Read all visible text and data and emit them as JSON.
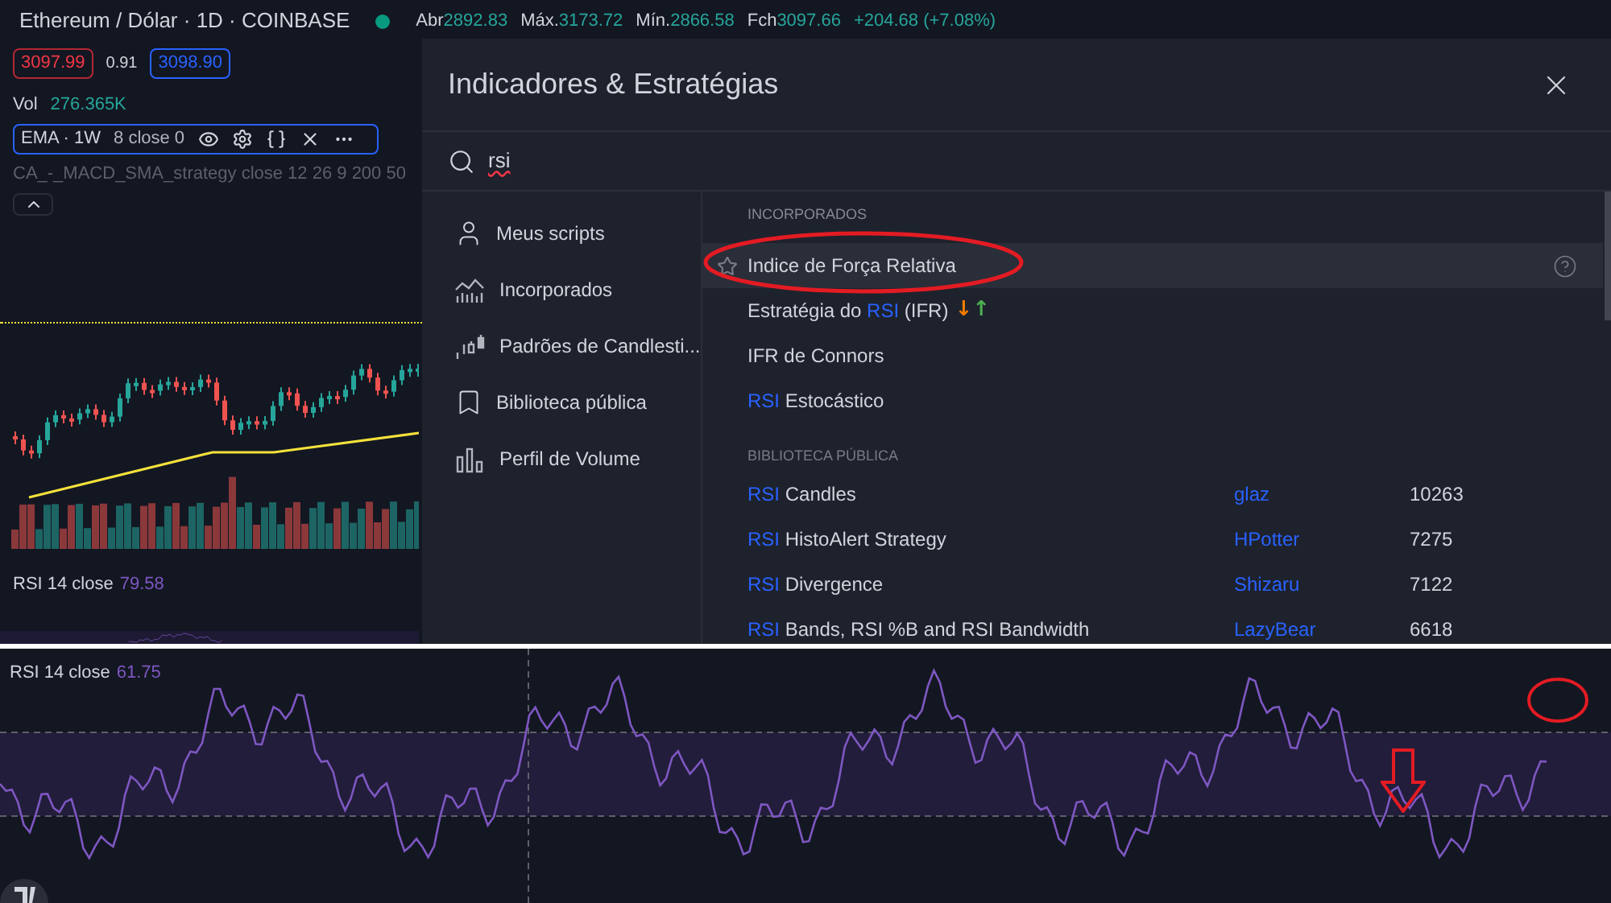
{
  "header": {
    "symbol": "Ethereum / Dólar · 1D · COINBASE",
    "ohlc": [
      {
        "label": "Abr",
        "value": "2892.83"
      },
      {
        "label": "Máx.",
        "value": "3173.72"
      },
      {
        "label": "Mín.",
        "value": "2866.58"
      },
      {
        "label": "Fch",
        "value": "3097.66"
      }
    ],
    "change": "+204.68 (+7.08%)"
  },
  "quote": {
    "bid": "3097.99",
    "spread": "0.91",
    "ask": "3098.90"
  },
  "volume": {
    "label": "Vol",
    "value": "276.365K"
  },
  "ema": {
    "name": "EMA · 1W",
    "params": "8 close 0"
  },
  "strategy": "CA_-_MACD_SMA_strategy close 12 26 9 200 50",
  "rsi_top": {
    "label": "RSI 14 close",
    "value": "79.58"
  },
  "dialog": {
    "title": "Indicadores & Estratégias",
    "search": "rsi",
    "nav": [
      {
        "label": "Meus scripts",
        "kind": "user"
      },
      {
        "label": "Incorporados",
        "kind": "builtin"
      },
      {
        "label": "Padrões de Candlesti...",
        "kind": "candles"
      },
      {
        "label": "Biblioteca pública",
        "kind": "bookmark"
      },
      {
        "label": "Perfil de Volume",
        "kind": "volume"
      }
    ],
    "builtin": {
      "title": "INCORPORADOS",
      "items": [
        {
          "parts": [
            {
              "text": "Indice de Força Relativa",
              "match": false
            }
          ],
          "selected": true
        },
        {
          "parts": [
            {
              "text": "Estratégia do ",
              "match": false
            },
            {
              "text": "RSI",
              "match": true
            },
            {
              "text": " (IFR)",
              "match": false
            }
          ],
          "selected": false,
          "signals": [
            {
              "text": "↓",
              "color": "#f57c00"
            },
            {
              "text": "↑",
              "color": "#4caf50"
            }
          ]
        },
        {
          "parts": [
            {
              "text": "IFR de Connors",
              "match": false
            }
          ],
          "selected": false
        },
        {
          "parts": [
            {
              "text": "RSI",
              "match": true
            },
            {
              "text": " Estocástico",
              "match": false
            }
          ],
          "selected": false
        }
      ]
    },
    "library": {
      "title": "BIBLIOTECA PÚBLICA",
      "items": [
        {
          "parts": [
            {
              "text": "RSI",
              "match": true
            },
            {
              "text": " Candles",
              "match": false
            }
          ],
          "author": "glaz",
          "count": "10263"
        },
        {
          "parts": [
            {
              "text": "RSI",
              "match": true
            },
            {
              "text": " HistoAlert Strategy",
              "match": false
            }
          ],
          "author": "HPotter",
          "count": "7275"
        },
        {
          "parts": [
            {
              "text": "RSI",
              "match": true
            },
            {
              "text": " Divergence",
              "match": false
            }
          ],
          "author": "Shizaru",
          "count": "7122"
        },
        {
          "parts": [
            {
              "text": "RSI",
              "match": true
            },
            {
              "text": " Bands, RSI %B and RSI Bandwidth",
              "match": false
            }
          ],
          "author": "LazyBear",
          "count": "6618"
        }
      ]
    }
  },
  "rsi_bottom": {
    "label": "RSI 14 close",
    "value": "61.75"
  }
}
